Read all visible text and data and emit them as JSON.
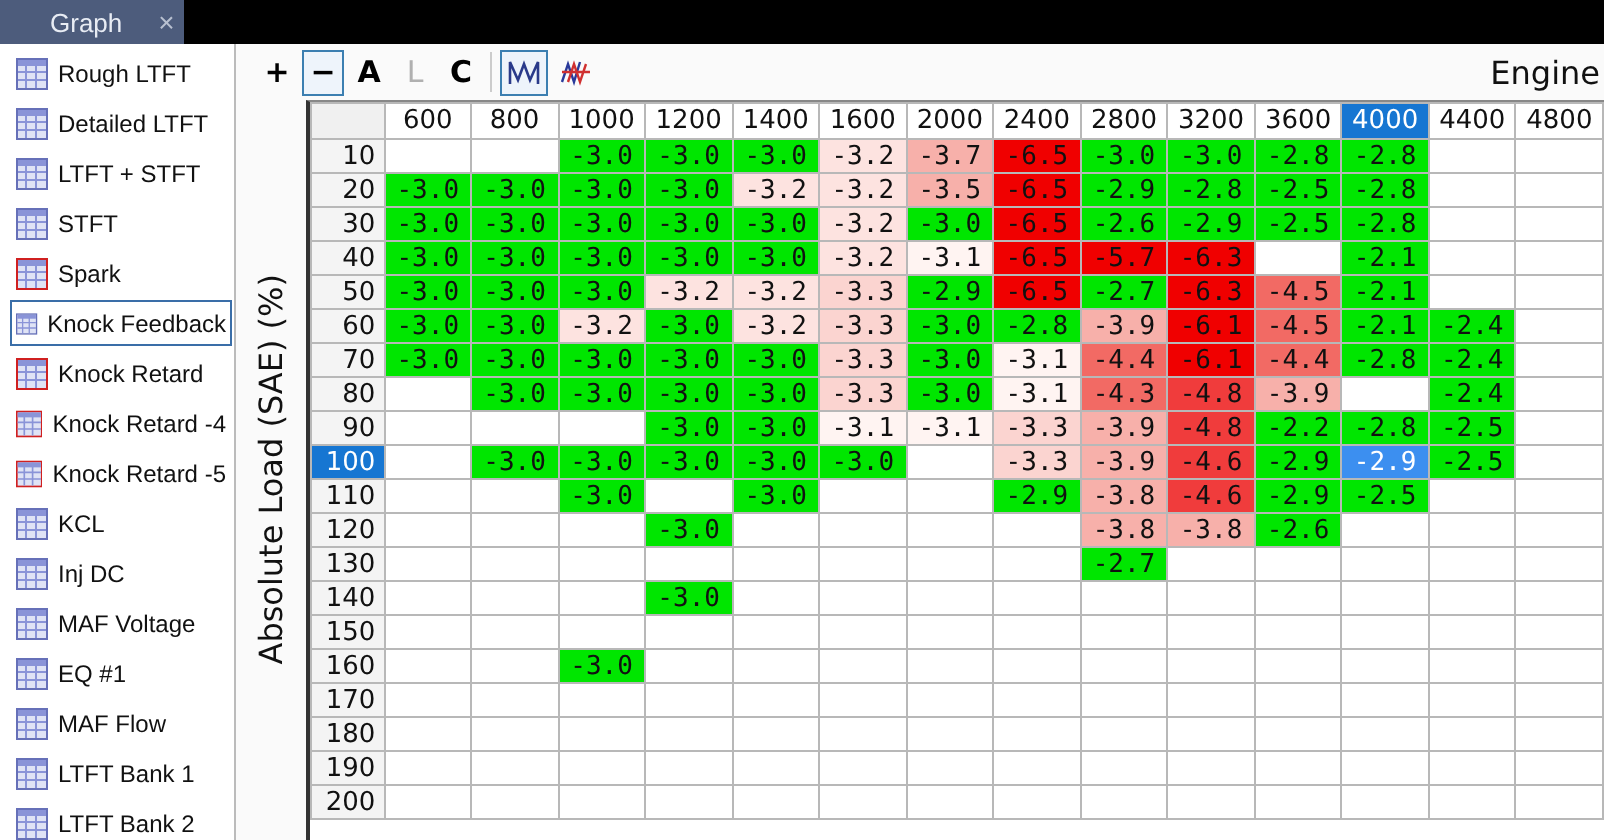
{
  "tab": {
    "label": "Graph",
    "close": "×"
  },
  "sidebar": {
    "items": [
      {
        "label": "Rough LTFT",
        "kind": "plain",
        "selected": false
      },
      {
        "label": "Detailed LTFT",
        "kind": "plain",
        "selected": false
      },
      {
        "label": "LTFT + STFT",
        "kind": "plain",
        "selected": false
      },
      {
        "label": "STFT",
        "kind": "plain",
        "selected": false
      },
      {
        "label": "Spark",
        "kind": "marked",
        "selected": false
      },
      {
        "label": "Knock Feedback",
        "kind": "plain",
        "selected": true
      },
      {
        "label": "Knock Retard",
        "kind": "marked",
        "selected": false
      },
      {
        "label": "Knock Retard -4",
        "kind": "marked",
        "selected": false
      },
      {
        "label": "Knock Retard -5",
        "kind": "marked",
        "selected": false
      },
      {
        "label": "KCL",
        "kind": "plain",
        "selected": false
      },
      {
        "label": "Inj DC",
        "kind": "plain",
        "selected": false
      },
      {
        "label": "MAF Voltage",
        "kind": "plain",
        "selected": false
      },
      {
        "label": "EQ #1",
        "kind": "plain",
        "selected": false
      },
      {
        "label": "MAF Flow",
        "kind": "plain",
        "selected": false
      },
      {
        "label": "LTFT Bank 1",
        "kind": "plain",
        "selected": false
      },
      {
        "label": "LTFT Bank 2",
        "kind": "plain",
        "selected": false
      }
    ]
  },
  "toolbar": [
    {
      "kind": "text",
      "label": "+",
      "selected": false,
      "disabled": false
    },
    {
      "kind": "text",
      "label": "−",
      "selected": true,
      "disabled": false
    },
    {
      "kind": "text",
      "label": "A",
      "selected": false,
      "disabled": false
    },
    {
      "kind": "text",
      "label": "L",
      "selected": false,
      "disabled": true
    },
    {
      "kind": "text",
      "label": "C",
      "selected": false,
      "disabled": false
    },
    {
      "kind": "line",
      "selected": true
    },
    {
      "kind": "split",
      "selected": false
    }
  ],
  "x_axis_title": "Engine",
  "y_axis_title": "Absolute Load (SAE) (%)",
  "table": {
    "columns": [
      {
        "label": "600",
        "selected": false
      },
      {
        "label": "800",
        "selected": false
      },
      {
        "label": "1000",
        "selected": false
      },
      {
        "label": "1200",
        "selected": false
      },
      {
        "label": "1400",
        "selected": false
      },
      {
        "label": "1600",
        "selected": false
      },
      {
        "label": "2000",
        "selected": false
      },
      {
        "label": "2400",
        "selected": false
      },
      {
        "label": "2800",
        "selected": false
      },
      {
        "label": "3200",
        "selected": false
      },
      {
        "label": "3600",
        "selected": false
      },
      {
        "label": "4000",
        "selected": true
      },
      {
        "label": "4400",
        "selected": false
      },
      {
        "label": "4800",
        "selected": false
      }
    ],
    "rows": [
      {
        "label": "10",
        "selected": false,
        "cells": [
          null,
          null,
          {
            "v": "-3.0",
            "color": "#00e600"
          },
          {
            "v": "-3.0",
            "color": "#00e600"
          },
          {
            "v": "-3.0",
            "color": "#00e600"
          },
          {
            "v": "-3.2",
            "color": "#fde3e0"
          },
          {
            "v": "-3.7",
            "color": "#f7b0aa"
          },
          {
            "v": "-6.5",
            "color": "#f00000"
          },
          {
            "v": "-3.0",
            "color": "#00e600"
          },
          {
            "v": "-3.0",
            "color": "#00e600"
          },
          {
            "v": "-2.8",
            "color": "#00e600"
          },
          {
            "v": "-2.8",
            "color": "#00e600"
          },
          null,
          null
        ]
      },
      {
        "label": "20",
        "selected": false,
        "cells": [
          {
            "v": "-3.0",
            "color": "#00e600"
          },
          {
            "v": "-3.0",
            "color": "#00e600"
          },
          {
            "v": "-3.0",
            "color": "#00e600"
          },
          {
            "v": "-3.0",
            "color": "#00e600"
          },
          {
            "v": "-3.2",
            "color": "#fde3e0"
          },
          {
            "v": "-3.2",
            "color": "#fde3e0"
          },
          {
            "v": "-3.5",
            "color": "#f7b0aa"
          },
          {
            "v": "-6.5",
            "color": "#f00000"
          },
          {
            "v": "-2.9",
            "color": "#00e600"
          },
          {
            "v": "-2.8",
            "color": "#00e600"
          },
          {
            "v": "-2.5",
            "color": "#00e600"
          },
          {
            "v": "-2.8",
            "color": "#00e600"
          },
          null,
          null
        ]
      },
      {
        "label": "30",
        "selected": false,
        "cells": [
          {
            "v": "-3.0",
            "color": "#00e600"
          },
          {
            "v": "-3.0",
            "color": "#00e600"
          },
          {
            "v": "-3.0",
            "color": "#00e600"
          },
          {
            "v": "-3.0",
            "color": "#00e600"
          },
          {
            "v": "-3.0",
            "color": "#00e600"
          },
          {
            "v": "-3.2",
            "color": "#fde3e0"
          },
          {
            "v": "-3.0",
            "color": "#00e600"
          },
          {
            "v": "-6.5",
            "color": "#f00000"
          },
          {
            "v": "-2.6",
            "color": "#00e600"
          },
          {
            "v": "-2.9",
            "color": "#00e600"
          },
          {
            "v": "-2.5",
            "color": "#00e600"
          },
          {
            "v": "-2.8",
            "color": "#00e600"
          },
          null,
          null
        ]
      },
      {
        "label": "40",
        "selected": false,
        "cells": [
          {
            "v": "-3.0",
            "color": "#00e600"
          },
          {
            "v": "-3.0",
            "color": "#00e600"
          },
          {
            "v": "-3.0",
            "color": "#00e600"
          },
          {
            "v": "-3.0",
            "color": "#00e600"
          },
          {
            "v": "-3.0",
            "color": "#00e600"
          },
          {
            "v": "-3.2",
            "color": "#fde3e0"
          },
          {
            "v": "-3.1",
            "color": "#fff4f2"
          },
          {
            "v": "-6.5",
            "color": "#f00000"
          },
          {
            "v": "-5.7",
            "color": "#f00000"
          },
          {
            "v": "-6.3",
            "color": "#f00000"
          },
          null,
          {
            "v": "-2.1",
            "color": "#00e600"
          },
          null,
          null
        ]
      },
      {
        "label": "50",
        "selected": false,
        "cells": [
          {
            "v": "-3.0",
            "color": "#00e600"
          },
          {
            "v": "-3.0",
            "color": "#00e600"
          },
          {
            "v": "-3.0",
            "color": "#00e600"
          },
          {
            "v": "-3.2",
            "color": "#fde3e0"
          },
          {
            "v": "-3.2",
            "color": "#fde3e0"
          },
          {
            "v": "-3.3",
            "color": "#fbd4d0"
          },
          {
            "v": "-2.9",
            "color": "#00e600"
          },
          {
            "v": "-6.5",
            "color": "#f00000"
          },
          {
            "v": "-2.7",
            "color": "#00e600"
          },
          {
            "v": "-6.3",
            "color": "#f00000"
          },
          {
            "v": "-4.5",
            "color": "#f26a64"
          },
          {
            "v": "-2.1",
            "color": "#00e600"
          },
          null,
          null
        ]
      },
      {
        "label": "60",
        "selected": false,
        "cells": [
          {
            "v": "-3.0",
            "color": "#00e600"
          },
          {
            "v": "-3.0",
            "color": "#00e600"
          },
          {
            "v": "-3.2",
            "color": "#fde3e0"
          },
          {
            "v": "-3.0",
            "color": "#00e600"
          },
          {
            "v": "-3.2",
            "color": "#fde3e0"
          },
          {
            "v": "-3.3",
            "color": "#fbd4d0"
          },
          {
            "v": "-3.0",
            "color": "#00e600"
          },
          {
            "v": "-2.8",
            "color": "#00e600"
          },
          {
            "v": "-3.9",
            "color": "#f7b0aa"
          },
          {
            "v": "-6.1",
            "color": "#f00000"
          },
          {
            "v": "-4.5",
            "color": "#f26a64"
          },
          {
            "v": "-2.1",
            "color": "#00e600"
          },
          {
            "v": "-2.4",
            "color": "#00e600"
          },
          null
        ]
      },
      {
        "label": "70",
        "selected": false,
        "cells": [
          {
            "v": "-3.0",
            "color": "#00e600"
          },
          {
            "v": "-3.0",
            "color": "#00e600"
          },
          {
            "v": "-3.0",
            "color": "#00e600"
          },
          {
            "v": "-3.0",
            "color": "#00e600"
          },
          {
            "v": "-3.0",
            "color": "#00e600"
          },
          {
            "v": "-3.3",
            "color": "#fbd4d0"
          },
          {
            "v": "-3.0",
            "color": "#00e600"
          },
          {
            "v": "-3.1",
            "color": "#fff4f2"
          },
          {
            "v": "-4.4",
            "color": "#f26a64"
          },
          {
            "v": "-6.1",
            "color": "#f00000"
          },
          {
            "v": "-4.4",
            "color": "#f26a64"
          },
          {
            "v": "-2.8",
            "color": "#00e600"
          },
          {
            "v": "-2.4",
            "color": "#00e600"
          },
          null
        ]
      },
      {
        "label": "80",
        "selected": false,
        "cells": [
          null,
          {
            "v": "-3.0",
            "color": "#00e600"
          },
          {
            "v": "-3.0",
            "color": "#00e600"
          },
          {
            "v": "-3.0",
            "color": "#00e600"
          },
          {
            "v": "-3.0",
            "color": "#00e600"
          },
          {
            "v": "-3.3",
            "color": "#fbd4d0"
          },
          {
            "v": "-3.0",
            "color": "#00e600"
          },
          {
            "v": "-3.1",
            "color": "#fff4f2"
          },
          {
            "v": "-4.3",
            "color": "#f26a64"
          },
          {
            "v": "-4.8",
            "color": "#f03c3c"
          },
          {
            "v": "-3.9",
            "color": "#f7b0aa"
          },
          null,
          {
            "v": "-2.4",
            "color": "#00e600"
          },
          null
        ]
      },
      {
        "label": "90",
        "selected": false,
        "cells": [
          null,
          null,
          null,
          {
            "v": "-3.0",
            "color": "#00e600"
          },
          {
            "v": "-3.0",
            "color": "#00e600"
          },
          {
            "v": "-3.1",
            "color": "#fff4f2"
          },
          {
            "v": "-3.1",
            "color": "#fff4f2"
          },
          {
            "v": "-3.3",
            "color": "#fbd4d0"
          },
          {
            "v": "-3.9",
            "color": "#f7b0aa"
          },
          {
            "v": "-4.8",
            "color": "#f03c3c"
          },
          {
            "v": "-2.2",
            "color": "#00e600"
          },
          {
            "v": "-2.8",
            "color": "#00e600"
          },
          {
            "v": "-2.5",
            "color": "#00e600"
          },
          null
        ]
      },
      {
        "label": "100",
        "selected": true,
        "cells": [
          null,
          {
            "v": "-3.0",
            "color": "#00e600"
          },
          {
            "v": "-3.0",
            "color": "#00e600"
          },
          {
            "v": "-3.0",
            "color": "#00e600"
          },
          {
            "v": "-3.0",
            "color": "#00e600"
          },
          {
            "v": "-3.0",
            "color": "#00e600"
          },
          null,
          {
            "v": "-3.3",
            "color": "#fbd4d0"
          },
          {
            "v": "-3.9",
            "color": "#f7b0aa"
          },
          {
            "v": "-4.6",
            "color": "#f03c3c"
          },
          {
            "v": "-2.9",
            "color": "#00e600"
          },
          {
            "v": "-2.9",
            "color": "#3c8ff0"
          },
          {
            "v": "-2.5",
            "color": "#00e600"
          },
          null
        ]
      },
      {
        "label": "110",
        "selected": false,
        "cells": [
          null,
          null,
          {
            "v": "-3.0",
            "color": "#00e600"
          },
          null,
          {
            "v": "-3.0",
            "color": "#00e600"
          },
          null,
          null,
          {
            "v": "-2.9",
            "color": "#00e600"
          },
          {
            "v": "-3.8",
            "color": "#f7b0aa"
          },
          {
            "v": "-4.6",
            "color": "#f03c3c"
          },
          {
            "v": "-2.9",
            "color": "#00e600"
          },
          {
            "v": "-2.5",
            "color": "#00e600"
          },
          null,
          null
        ]
      },
      {
        "label": "120",
        "selected": false,
        "cells": [
          null,
          null,
          null,
          {
            "v": "-3.0",
            "color": "#00e600"
          },
          null,
          null,
          null,
          null,
          {
            "v": "-3.8",
            "color": "#f7b0aa"
          },
          {
            "v": "-3.8",
            "color": "#f7b0aa"
          },
          {
            "v": "-2.6",
            "color": "#00e600"
          },
          null,
          null,
          null
        ]
      },
      {
        "label": "130",
        "selected": false,
        "cells": [
          null,
          null,
          null,
          null,
          null,
          null,
          null,
          null,
          {
            "v": "-2.7",
            "color": "#00e600"
          },
          null,
          null,
          null,
          null,
          null
        ]
      },
      {
        "label": "140",
        "selected": false,
        "cells": [
          null,
          null,
          null,
          {
            "v": "-3.0",
            "color": "#00e600"
          },
          null,
          null,
          null,
          null,
          null,
          null,
          null,
          null,
          null,
          null
        ]
      },
      {
        "label": "150",
        "selected": false,
        "cells": [
          null,
          null,
          null,
          null,
          null,
          null,
          null,
          null,
          null,
          null,
          null,
          null,
          null,
          null
        ]
      },
      {
        "label": "160",
        "selected": false,
        "cells": [
          null,
          null,
          {
            "v": "-3.0",
            "color": "#00e600"
          },
          null,
          null,
          null,
          null,
          null,
          null,
          null,
          null,
          null,
          null,
          null
        ]
      },
      {
        "label": "170",
        "selected": false,
        "cells": [
          null,
          null,
          null,
          null,
          null,
          null,
          null,
          null,
          null,
          null,
          null,
          null,
          null,
          null
        ]
      },
      {
        "label": "180",
        "selected": false,
        "cells": [
          null,
          null,
          null,
          null,
          null,
          null,
          null,
          null,
          null,
          null,
          null,
          null,
          null,
          null
        ]
      },
      {
        "label": "190",
        "selected": false,
        "cells": [
          null,
          null,
          null,
          null,
          null,
          null,
          null,
          null,
          null,
          null,
          null,
          null,
          null,
          null
        ]
      },
      {
        "label": "200",
        "selected": false,
        "cells": [
          null,
          null,
          null,
          null,
          null,
          null,
          null,
          null,
          null,
          null,
          null,
          null,
          null,
          null
        ]
      }
    ]
  }
}
